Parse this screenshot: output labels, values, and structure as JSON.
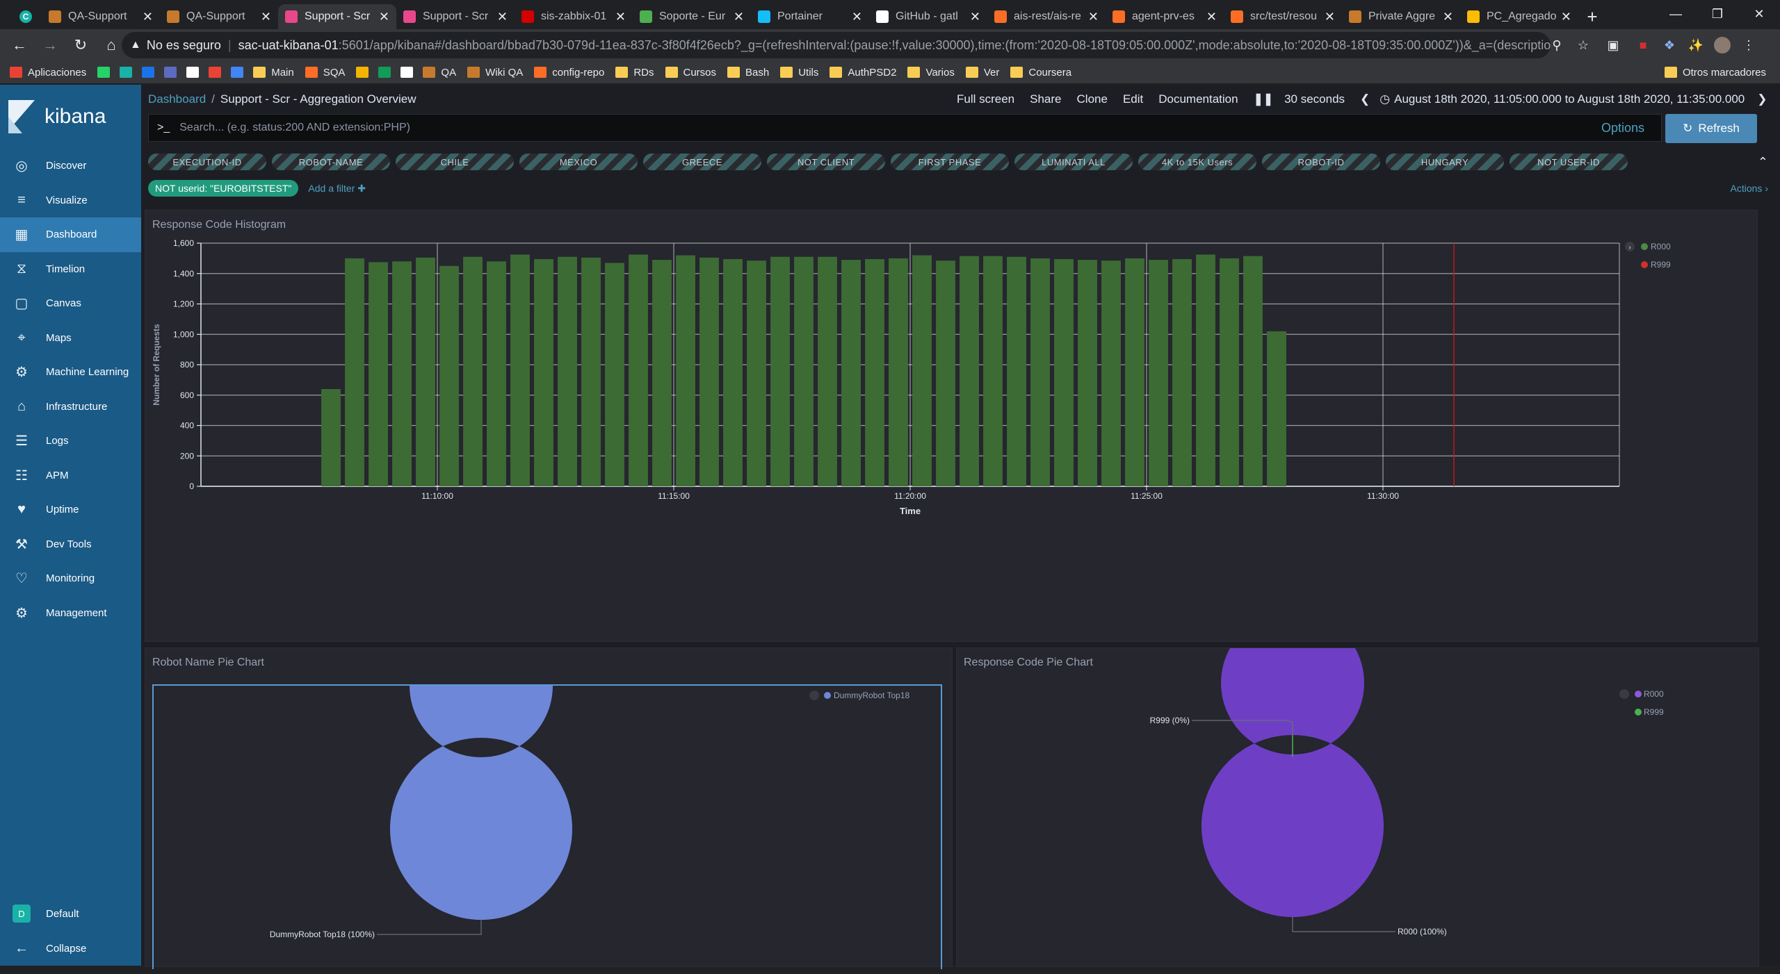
{
  "browser": {
    "tabs": [
      {
        "title": "",
        "icon_color": "#19b2a7",
        "icon": "chromium-profile-icon"
      },
      {
        "title": "QA-Support",
        "icon_color": "#c77a2c",
        "icon": "grafana-icon"
      },
      {
        "title": "QA-Support",
        "icon_color": "#c77a2c",
        "icon": "grafana-icon"
      },
      {
        "title": "Support - Scr",
        "icon_color": "#e8478b",
        "icon": "kibana-icon"
      },
      {
        "title": "Support - Scr",
        "icon_color": "#e8478b",
        "icon": "kibana-icon"
      },
      {
        "title": "sis-zabbix-01",
        "icon_color": "#d40000",
        "icon": "zabbix-icon"
      },
      {
        "title": "Soporte - Eur",
        "icon_color": "#4caf50",
        "icon": "app-icon"
      },
      {
        "title": "Portainer",
        "icon_color": "#13bef9",
        "icon": "portainer-icon"
      },
      {
        "title": "GitHub - gatl",
        "icon_color": "#ffffff",
        "icon": "github-icon"
      },
      {
        "title": "ais-rest/ais-re",
        "icon_color": "#fc6d26",
        "icon": "gitlab-icon"
      },
      {
        "title": "agent-prv-es",
        "icon_color": "#fc6d26",
        "icon": "gitlab-icon"
      },
      {
        "title": "src/test/resou",
        "icon_color": "#fc6d26",
        "icon": "gitlab-icon"
      },
      {
        "title": "Private Aggre",
        "icon_color": "#c77a2c",
        "icon": "grafana-icon"
      },
      {
        "title": "PC_Agregado",
        "icon_color": "#fbbc04",
        "icon": "drive-icon"
      }
    ],
    "active_tab": 3,
    "address": {
      "security": "No es seguro",
      "host": "sac-uat-kibana-01",
      "path": ":5601/app/kibana#/dashboard/bbad7b30-079d-11ea-837c-3f80f4f26ecb?_g=(refreshInterval:(pause:!f,value:30000),time:(from:'2020-08-18T09:05:00.000Z',mode:absolute,to:'2020-08-18T09:35:00.000Z'))&_a=(description:'Ge..."
    },
    "bookmarks": [
      {
        "label": "Aplicaciones",
        "color": "#e94235"
      },
      {
        "label": "",
        "color": "#25d366"
      },
      {
        "label": "",
        "color": "#19b2a7"
      },
      {
        "label": "",
        "color": "#1a73e8"
      },
      {
        "label": "",
        "color": "#5c6bc0"
      },
      {
        "label": "",
        "color": "#ffffff"
      },
      {
        "label": "",
        "color": "#ea4335"
      },
      {
        "label": "",
        "color": "#4285f4"
      },
      {
        "label": "Main",
        "color": "#f9cc55"
      },
      {
        "label": "SQA",
        "color": "#fc6d26"
      },
      {
        "label": "",
        "color": "#f4b400"
      },
      {
        "label": "",
        "color": "#0f9d58"
      },
      {
        "label": "",
        "color": "#ffffff"
      },
      {
        "label": "QA",
        "color": "#c77a2c"
      },
      {
        "label": "Wiki QA",
        "color": "#c77a2c"
      },
      {
        "label": "config-repo",
        "color": "#fc6d26"
      },
      {
        "label": "RDs",
        "color": "#f9cc55"
      },
      {
        "label": "Cursos",
        "color": "#f9cc55"
      },
      {
        "label": "Bash",
        "color": "#f9cc55"
      },
      {
        "label": "Utils",
        "color": "#f9cc55"
      },
      {
        "label": "AuthPSD2",
        "color": "#f9cc55"
      },
      {
        "label": "Varios",
        "color": "#f9cc55"
      },
      {
        "label": "Ver",
        "color": "#f9cc55"
      },
      {
        "label": "Coursera",
        "color": "#f9cc55"
      }
    ],
    "other_bookmarks": "Otros marcadores"
  },
  "kibana": {
    "brand": "kibana",
    "nav": [
      {
        "label": "Discover",
        "icon": "compass-icon"
      },
      {
        "label": "Visualize",
        "icon": "visualize-icon"
      },
      {
        "label": "Dashboard",
        "icon": "dashboard-icon"
      },
      {
        "label": "Timelion",
        "icon": "timelion-icon"
      },
      {
        "label": "Canvas",
        "icon": "canvas-icon"
      },
      {
        "label": "Maps",
        "icon": "maps-icon"
      },
      {
        "label": "Machine Learning",
        "icon": "machine-learning-icon"
      },
      {
        "label": "Infrastructure",
        "icon": "infrastructure-icon"
      },
      {
        "label": "Logs",
        "icon": "logs-icon"
      },
      {
        "label": "APM",
        "icon": "apm-icon"
      },
      {
        "label": "Uptime",
        "icon": "uptime-icon"
      },
      {
        "label": "Dev Tools",
        "icon": "wrench-icon"
      },
      {
        "label": "Monitoring",
        "icon": "monitoring-icon"
      },
      {
        "label": "Management",
        "icon": "gear-icon"
      }
    ],
    "active_nav": 2,
    "space": {
      "label": "Default",
      "initial": "D"
    },
    "collapse": "Collapse"
  },
  "dashboard": {
    "breadcrumb_root": "Dashboard",
    "breadcrumb_current": "Support - Scr - Aggregation Overview",
    "menu": [
      "Full screen",
      "Share",
      "Clone",
      "Edit",
      "Documentation"
    ],
    "refresh_interval": "30 seconds",
    "time_range": "August 18th 2020, 11:05:00.000 to August 18th 2020, 11:35:00.000",
    "query_placeholder": "Search... (e.g. status:200 AND extension:PHP)",
    "options": "Options",
    "refresh": "Refresh",
    "disabled_filters": [
      "EXECUTION-ID",
      "ROBOT-NAME",
      "CHILE",
      "MEXICO",
      "GREECE",
      "NOT CLIENT",
      "FIRST PHASE",
      "LUMINATI ALL",
      "4K to 15K Users",
      "ROBOT-ID",
      "HUNGARY",
      "NOT USER-ID"
    ],
    "active_filter": "NOT userid: \"EUROBITSTEST\"",
    "add_filter": "Add a filter",
    "actions": "Actions"
  },
  "panels": {
    "histogram_title": "Response Code Histogram",
    "robot_pie_title": "Robot Name Pie Chart",
    "response_pie_title": "Response Code Pie Chart"
  },
  "chart_data": [
    {
      "type": "bar",
      "title": "Response Code Histogram",
      "xlabel": "Time",
      "ylabel": "Number of Requests",
      "ylim": [
        0,
        1600
      ],
      "yticks": [
        "0",
        "200",
        "400",
        "600",
        "800",
        "1,000",
        "1,200",
        "1,400",
        "1,600"
      ],
      "xticks": [
        "11:10:00",
        "11:15:00",
        "11:20:00",
        "11:25:00",
        "11:30:00"
      ],
      "x_start": "11:05:00",
      "x_end": "11:35:00",
      "bucket": "30s",
      "first_bucket": "11:07:30",
      "series": [
        {
          "name": "R000",
          "color": "#3d6b34",
          "values": [
            640,
            1500,
            1475,
            1480,
            1505,
            1450,
            1510,
            1480,
            1525,
            1495,
            1510,
            1505,
            1470,
            1525,
            1490,
            1520,
            1505,
            1495,
            1485,
            1510,
            1510,
            1510,
            1490,
            1495,
            1500,
            1520,
            1485,
            1515,
            1515,
            1510,
            1500,
            1495,
            1490,
            1485,
            1500,
            1490,
            1495,
            1525,
            1500,
            1515,
            1020
          ]
        },
        {
          "name": "R999",
          "color": "#bf1b1b",
          "values": []
        }
      ],
      "now_marker": "11:31:30",
      "legend": "right"
    },
    {
      "type": "pie",
      "title": "Robot Name Pie Chart",
      "slices": [
        {
          "label": "DummyRobot Top18",
          "value": 100,
          "color": "#6f87d8"
        }
      ],
      "labels": [
        "DummyRobot Top18 (100%)"
      ],
      "legend": "top-right"
    },
    {
      "type": "pie",
      "title": "Response Code Pie Chart",
      "slices": [
        {
          "label": "R000",
          "value": 100,
          "color": "#6e3fc5"
        },
        {
          "label": "R999",
          "value": 0,
          "color": "#4cb050"
        }
      ],
      "labels": [
        "R999 (0%)",
        "R000 (100%)"
      ],
      "legend": "top-right"
    }
  ]
}
